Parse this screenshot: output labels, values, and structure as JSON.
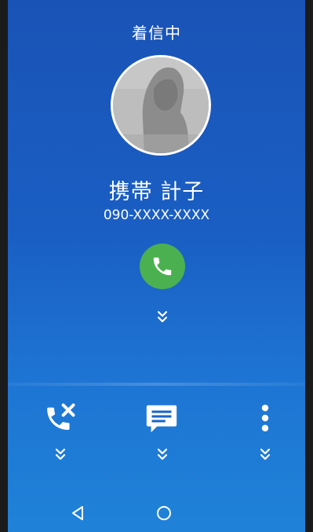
{
  "call": {
    "status": "着信中",
    "caller_name": "携帯 計子",
    "caller_number": "090-XXXX-XXXX"
  },
  "icons": {
    "avatar": "contact-photo",
    "answer": "phone-icon",
    "swipe_hint": "double-chevron-down-icon",
    "reject": "phone-reject-icon",
    "message": "message-icon",
    "more": "more-vert-icon",
    "back": "back-triangle-icon",
    "home": "home-circle-icon"
  },
  "colors": {
    "background_top": "#1a53b6",
    "background_bottom": "#1f82d8",
    "answer_button": "#4bb150",
    "foreground": "#ffffff"
  }
}
